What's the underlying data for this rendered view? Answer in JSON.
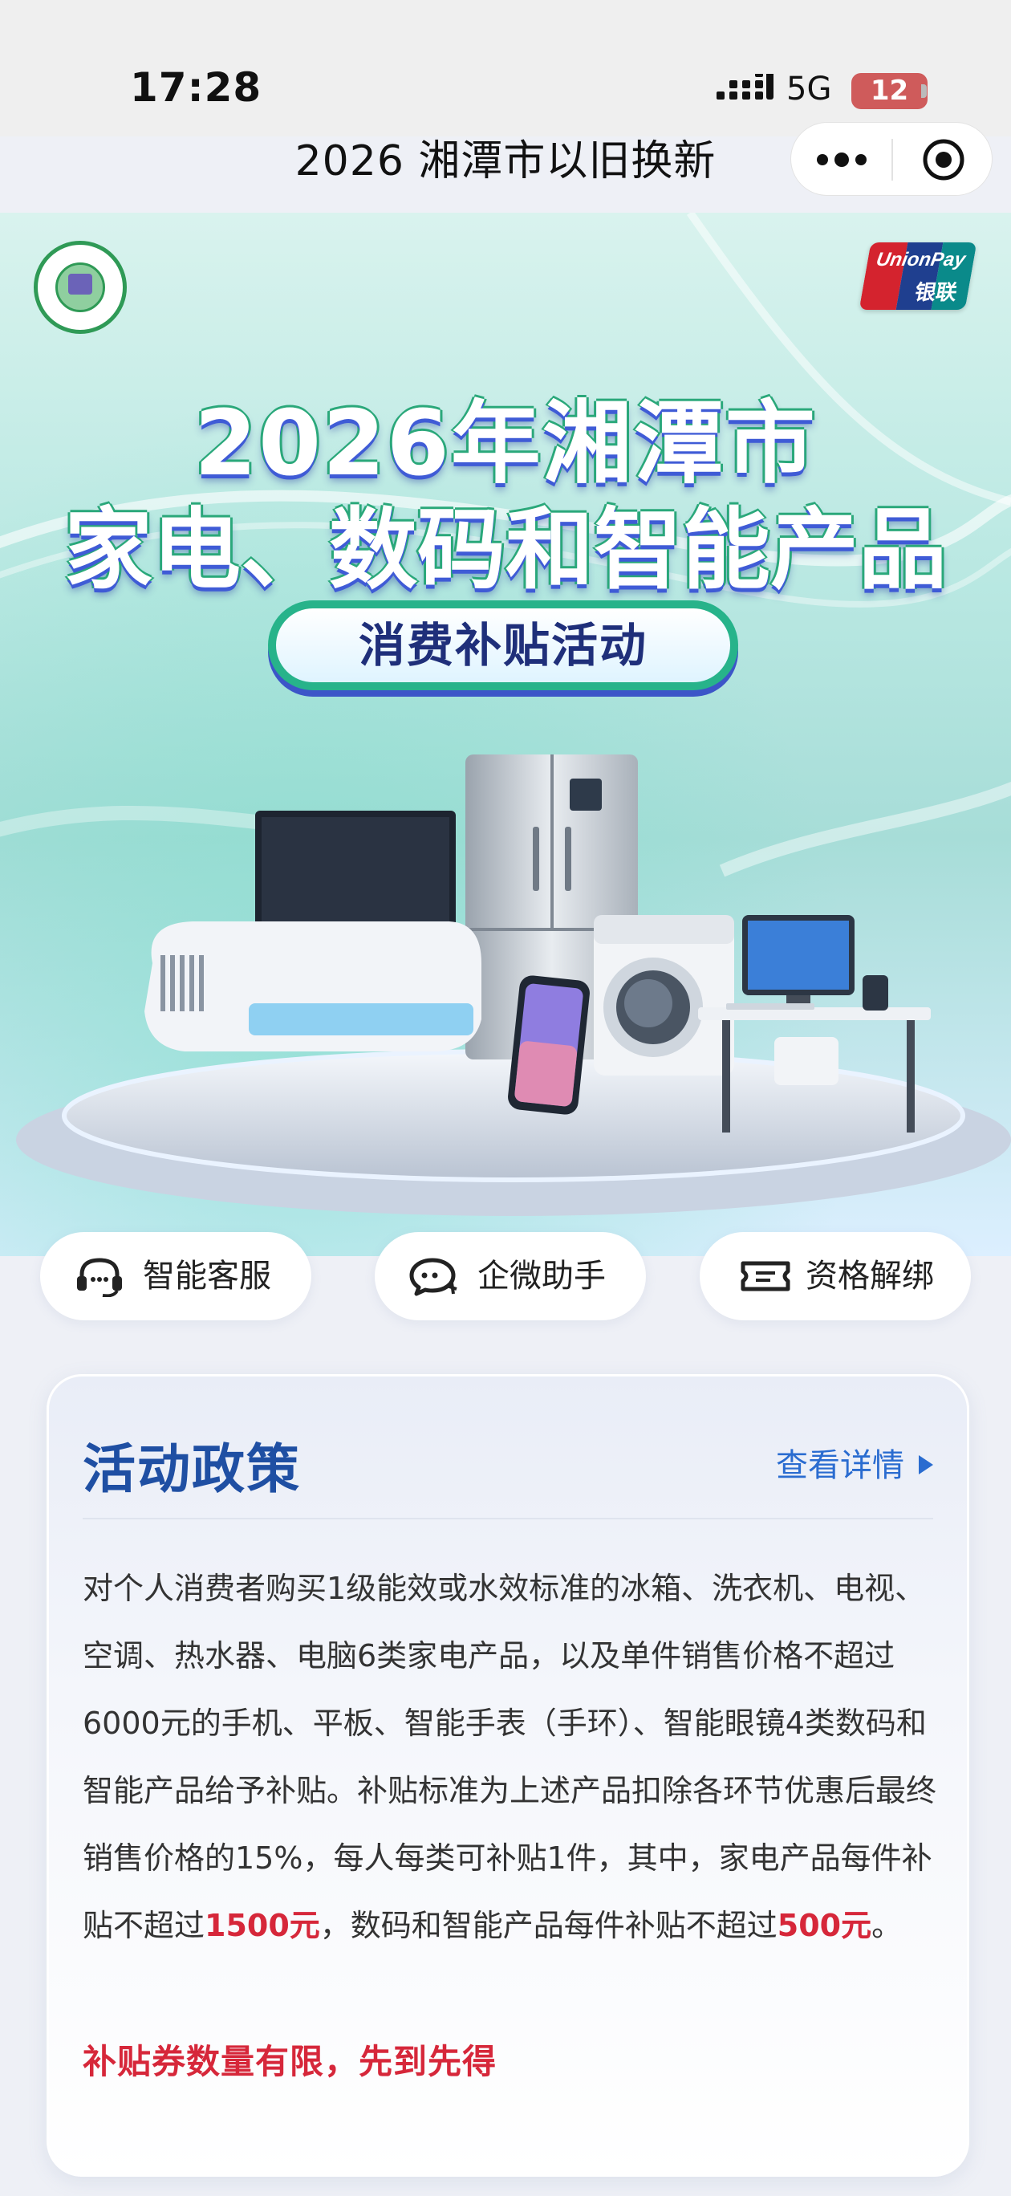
{
  "status_bar": {
    "time": "17:28",
    "network": "5G",
    "battery": "12"
  },
  "nav": {
    "title": "2026 湘潭市以旧换新",
    "more_icon": "more-dots-icon",
    "close_icon": "close-circle-icon"
  },
  "hero": {
    "headline_line1": "2026年湘潭市",
    "headline_line2": "家电、数码和智能产品",
    "subtitle_pill": "消费补贴活动",
    "unionpay_text": "UnionPay",
    "unionpay_cn": "银联",
    "colors": {
      "green": "#2aa87a",
      "blue": "#3f5bd6",
      "brand_red": "#d4232e"
    }
  },
  "actions": [
    {
      "label": "智能客服",
      "icon": "headset-icon"
    },
    {
      "label": "企微助手",
      "icon": "chat-bubble-icon"
    },
    {
      "label": "资格解绑",
      "icon": "ticket-icon"
    }
  ],
  "policy": {
    "title": "活动政策",
    "link_label": "查看详情",
    "body_part1": "对个人消费者购买1级能效或水效标准的冰箱、洗衣机、电视、空调、热水器、电脑6类家电产品，以及单件销售价格不超过6000元的手机、平板、智能手表（手环）、智能眼镜4类数码和智能产品给予补贴。补贴标准为上述产品扣除各环节优惠后最终销售价格的15%，每人每类可补贴1件，其中，家电产品每件补贴不超过",
    "amount_appliance": "1500元",
    "body_part2": "，数码和智能产品每件补贴不超过",
    "amount_digital": "500元",
    "body_part3": "。",
    "note": "补贴券数量有限，先到先得",
    "accent_color": "#d6273a",
    "title_color": "#1f4fa3"
  }
}
